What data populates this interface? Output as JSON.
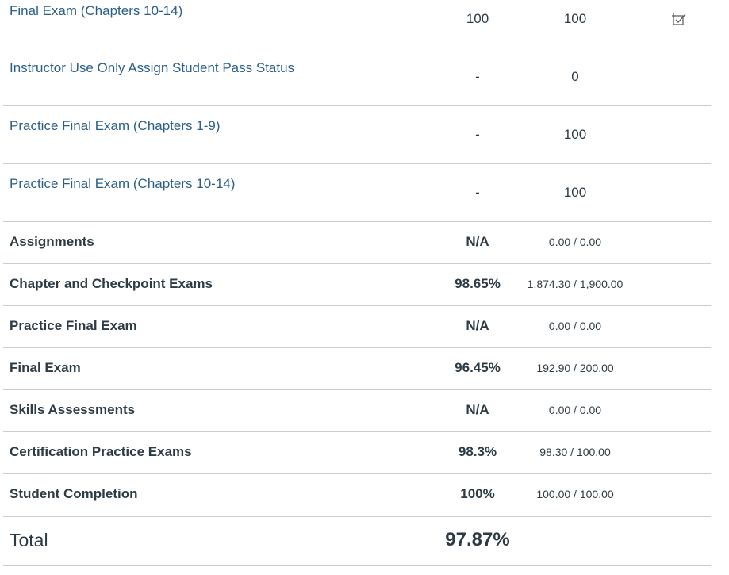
{
  "assignments": [
    {
      "name": "Final Exam (Chapters 10-14)",
      "score": "100",
      "out_of": "100",
      "icon": "rubric-checkbox-icon"
    },
    {
      "name": "Instructor Use Only Assign Student Pass Status",
      "score": "-",
      "out_of": "0"
    },
    {
      "name": "Practice Final Exam (Chapters 1-9)",
      "score": "-",
      "out_of": "100"
    },
    {
      "name": "Practice Final Exam (Chapters 10-14)",
      "score": "-",
      "out_of": "100"
    }
  ],
  "groups": [
    {
      "name": "Assignments",
      "percent": "N/A",
      "points": "0.00 / 0.00"
    },
    {
      "name": "Chapter and Checkpoint Exams",
      "percent": "98.65%",
      "points": "1,874.30 / 1,900.00"
    },
    {
      "name": "Practice Final Exam",
      "percent": "N/A",
      "points": "0.00 / 0.00"
    },
    {
      "name": "Final Exam",
      "percent": "96.45%",
      "points": "192.90 / 200.00"
    },
    {
      "name": "Skills Assessments",
      "percent": "N/A",
      "points": "0.00 / 0.00"
    },
    {
      "name": "Certification Practice Exams",
      "percent": "98.3%",
      "points": "98.30 / 100.00"
    },
    {
      "name": "Student Completion",
      "percent": "100%",
      "points": "100.00 / 100.00"
    }
  ],
  "total": {
    "label": "Total",
    "percent": "97.87%"
  },
  "colors": {
    "link": "#2b5f8a",
    "text": "#2d3b45",
    "divider": "#c7cdd1"
  }
}
